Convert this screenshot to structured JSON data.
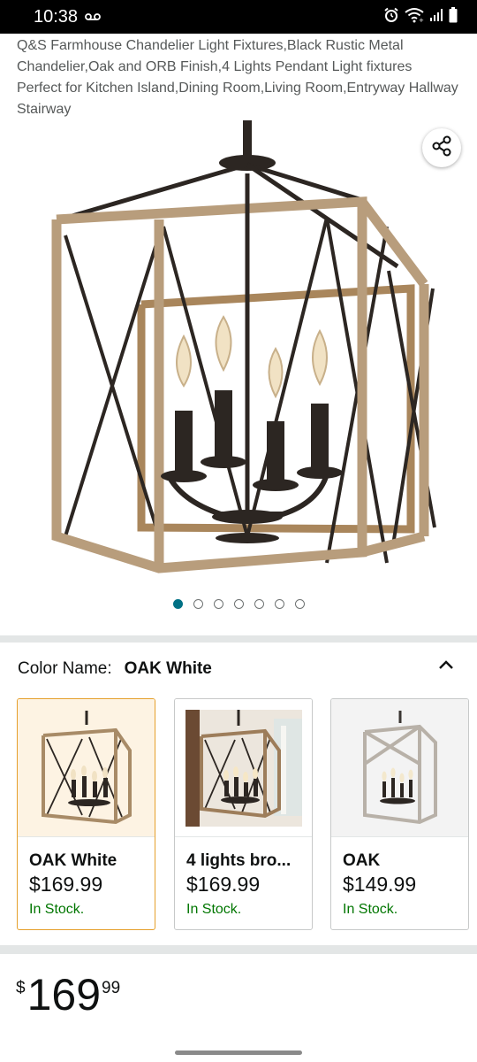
{
  "status_bar": {
    "time": "10:38",
    "voicemail_icon": "voicemail-icon",
    "icons": [
      "alarm-icon",
      "wifi-icon",
      "signal-icon",
      "battery-icon"
    ]
  },
  "product": {
    "title": "Q&S Farmhouse Chandelier Light Fixtures,Black Rustic Metal Chandelier,Oak and ORB Finish,4 Lights Pendant Light fixtures Perfect for Kitchen Island,Dining Room,Living Room,Entryway Hallway Stairway",
    "image_count": 7,
    "active_image_index": 0,
    "share_icon": "share-icon"
  },
  "color_selector": {
    "label": "Color Name:",
    "selected": "OAK White",
    "options": [
      {
        "name": "OAK White",
        "price": "$169.99",
        "stock": "In Stock."
      },
      {
        "name": "4 lights bro...",
        "price": "$169.99",
        "stock": "In Stock."
      },
      {
        "name": "OAK",
        "price": "$149.99",
        "stock": "In Stock."
      }
    ]
  },
  "price": {
    "symbol": "$",
    "whole": "169",
    "fraction": "99"
  },
  "colors": {
    "accent_teal": "#007185",
    "stock_green": "#007600",
    "selected_border": "#e5a02c"
  }
}
